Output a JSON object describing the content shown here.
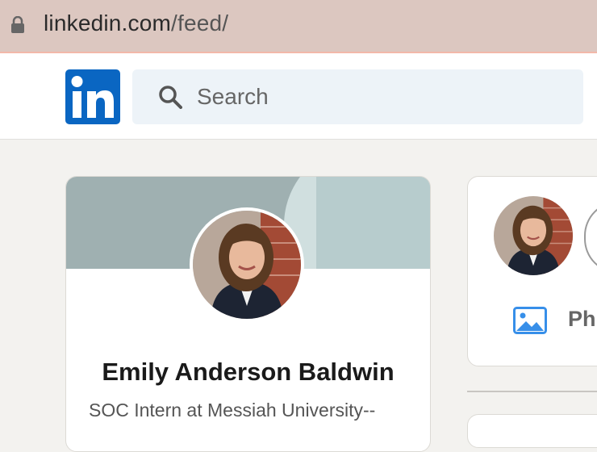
{
  "browser": {
    "url_host": "linkedin.com",
    "url_path": "/feed/"
  },
  "header": {
    "logo": "in",
    "search_placeholder": "Search"
  },
  "profile": {
    "name": "Emily Anderson Baldwin",
    "headline": "SOC Intern at Messiah University--"
  },
  "share_box": {
    "photo_label": "Ph"
  },
  "colors": {
    "linkedin_blue": "#0a66c2",
    "photo_icon": "#378fe9",
    "page_bg": "#f3f2ef"
  },
  "icons": [
    "lock-icon",
    "search-icon",
    "photo-icon"
  ]
}
